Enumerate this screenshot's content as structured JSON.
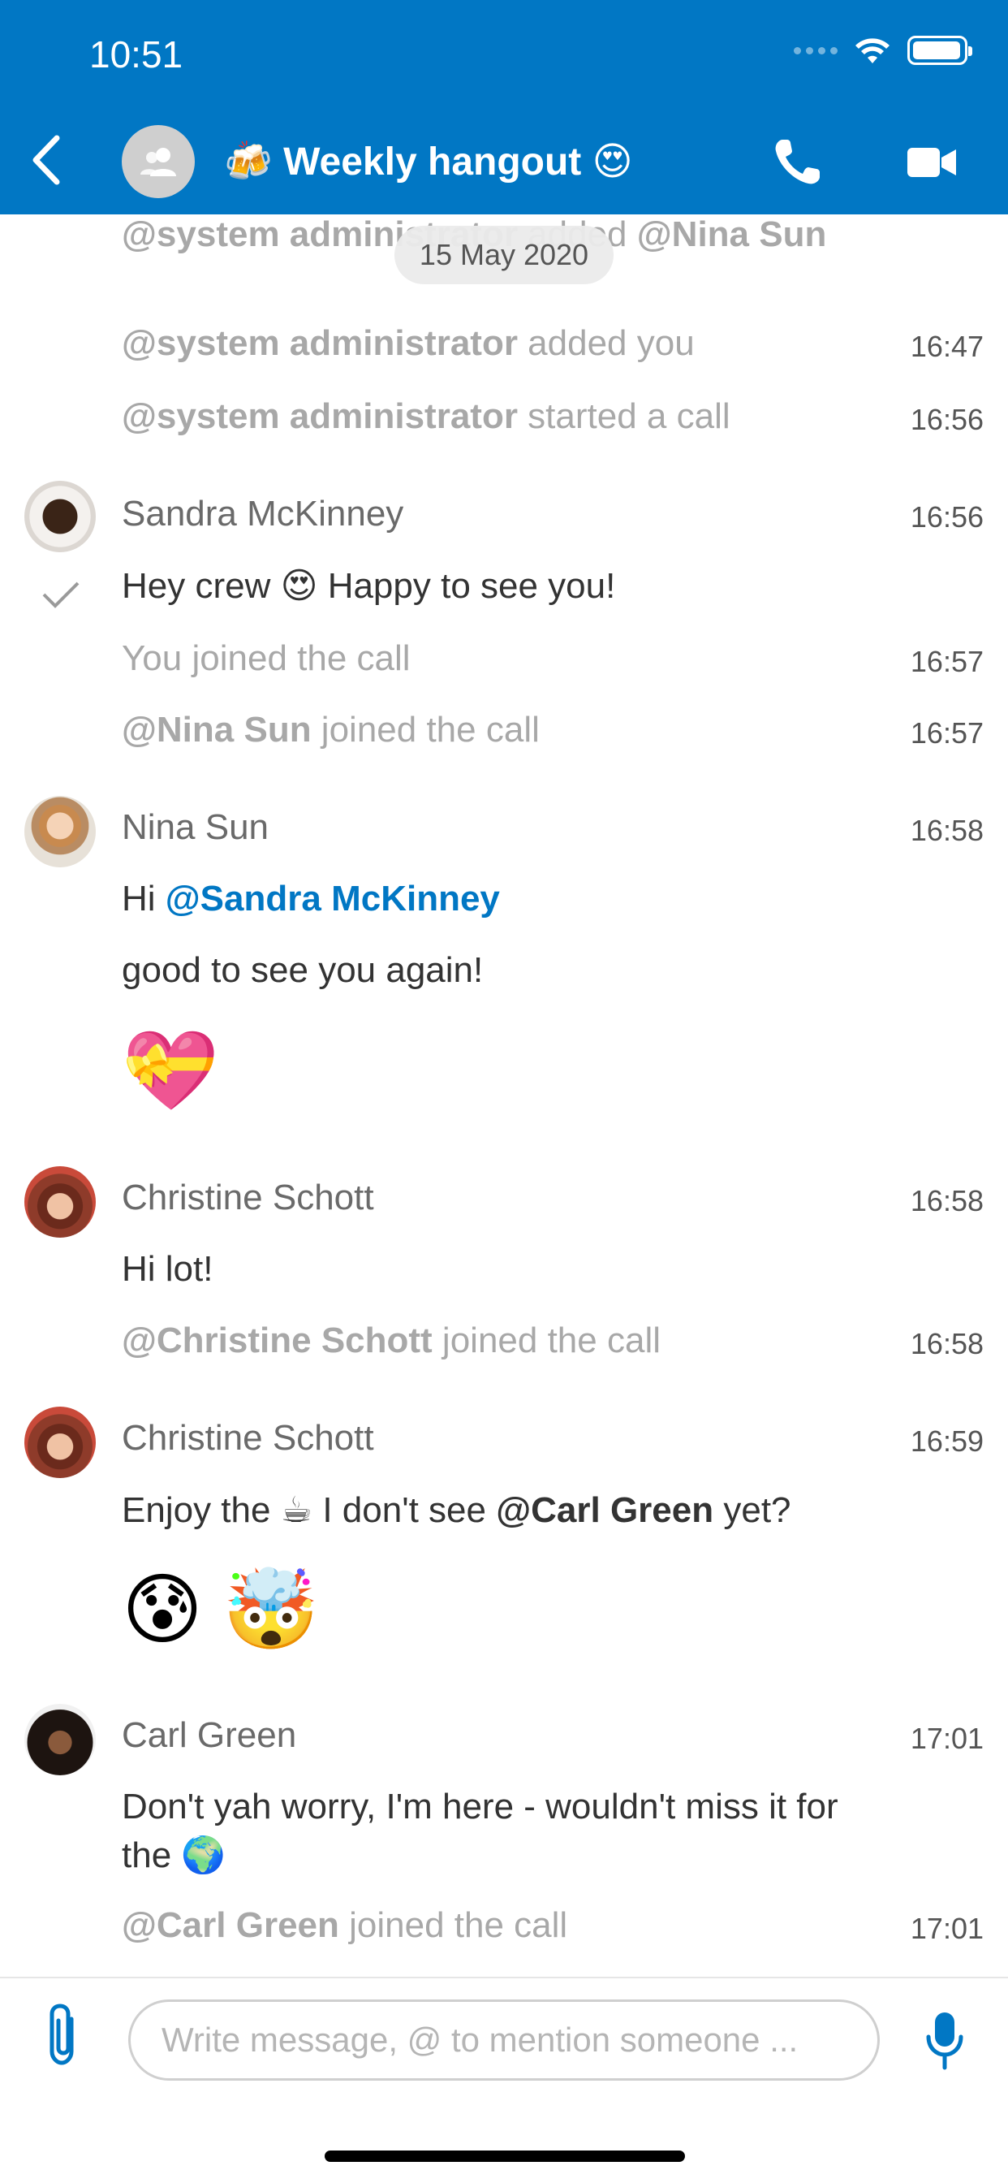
{
  "status_bar": {
    "time": "10:51"
  },
  "header": {
    "title": "🍻 Weekly hangout 😍",
    "brand_color": "#0177c4"
  },
  "date_chip": "15 May 2020",
  "messages": {
    "sys1": {
      "actor": "@system administrator",
      "text": " added ",
      "target": "@Nina Sun"
    },
    "sys2": {
      "actor": "@system administrator",
      "text": " added you",
      "time": "16:47"
    },
    "sys3": {
      "actor": "@system administrator",
      "text": " started a call",
      "time": "16:56"
    },
    "sandra": {
      "name": "Sandra McKinney",
      "time": "16:56",
      "text": "Hey crew 😍 Happy to see you!"
    },
    "sys4": {
      "text": "You joined the call",
      "time": "16:57"
    },
    "sys5": {
      "actor": "@Nina Sun",
      "text": " joined the call",
      "time": "16:57"
    },
    "nina": {
      "name": "Nina Sun",
      "time": "16:58",
      "line1_prefix": "Hi ",
      "line1_mention": "@Sandra McKinney",
      "line2": "good to see you again!",
      "emoji": "💝"
    },
    "christine1": {
      "name": "Christine Schott",
      "time": "16:58",
      "text": "Hi lot!"
    },
    "sys6": {
      "actor": "@Christine Schott",
      "text": " joined the call",
      "time": "16:58"
    },
    "christine2": {
      "name": "Christine Schott",
      "time": "16:59",
      "text_prefix": "Enjoy the ☕ I don't see ",
      "mention": "@Carl Green",
      "text_suffix": " yet?",
      "emoji1": "😰",
      "emoji2": "🤯"
    },
    "carl": {
      "name": "Carl Green",
      "time": "17:01",
      "line1": "Don't yah worry, I'm here - wouldn't miss it for",
      "line2": "the 🌍"
    },
    "sys7": {
      "actor": "@Carl Green",
      "text": " joined the call",
      "time": "17:01"
    }
  },
  "composer": {
    "placeholder": "Write message, @ to mention someone ..."
  }
}
